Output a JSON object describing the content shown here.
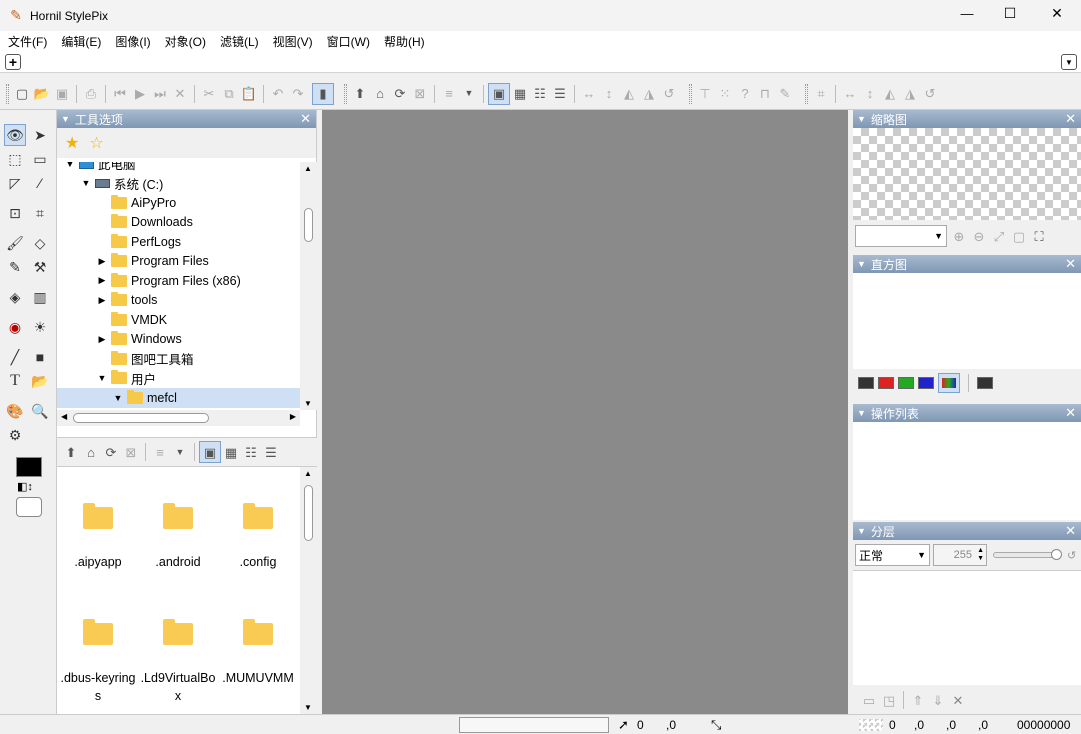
{
  "window": {
    "title": "Hornil StylePix",
    "minimize": "—",
    "maximize": "☐",
    "close": "✕"
  },
  "menu": [
    "文件(F)",
    "编辑(E)",
    "图像(I)",
    "对象(O)",
    "滤镜(L)",
    "视图(V)",
    "窗口(W)",
    "帮助(H)"
  ],
  "tool_options": {
    "title": "工具选项",
    "tree": [
      {
        "label": "此电脑",
        "indent": 1,
        "arrow": "down",
        "icon": "pc"
      },
      {
        "label": "系统 (C:)",
        "indent": 2,
        "arrow": "down",
        "icon": "drive"
      },
      {
        "label": "AiPyPro",
        "indent": 3,
        "arrow": "",
        "icon": "folder"
      },
      {
        "label": "Downloads",
        "indent": 3,
        "arrow": "",
        "icon": "folder"
      },
      {
        "label": "PerfLogs",
        "indent": 3,
        "arrow": "",
        "icon": "folder"
      },
      {
        "label": "Program Files",
        "indent": 3,
        "arrow": "right",
        "icon": "folder"
      },
      {
        "label": "Program Files (x86)",
        "indent": 3,
        "arrow": "right",
        "icon": "folder"
      },
      {
        "label": "tools",
        "indent": 3,
        "arrow": "right",
        "icon": "folder"
      },
      {
        "label": "VMDK",
        "indent": 3,
        "arrow": "",
        "icon": "folder"
      },
      {
        "label": "Windows",
        "indent": 3,
        "arrow": "right",
        "icon": "folder"
      },
      {
        "label": "图吧工具箱",
        "indent": 3,
        "arrow": "",
        "icon": "folder"
      },
      {
        "label": "用户",
        "indent": 3,
        "arrow": "down",
        "icon": "folder"
      },
      {
        "label": "mefcl",
        "indent": 4,
        "arrow": "down",
        "icon": "folder",
        "selected": true
      }
    ]
  },
  "file_grid": [
    {
      "label": ".aipyapp"
    },
    {
      "label": ".android"
    },
    {
      "label": ".config"
    },
    {
      "label": ".dbus-keyrings"
    },
    {
      "label": ".Ld9VirtualBox"
    },
    {
      "label": ".MUMUVMM"
    }
  ],
  "thumbnail_panel": {
    "title": "缩略图",
    "zoom_value": ""
  },
  "histogram_panel": {
    "title": "直方图"
  },
  "actions_panel": {
    "title": "操作列表"
  },
  "layers_panel": {
    "title": "分层",
    "blend_mode": "正常",
    "opacity": "255"
  },
  "status": {
    "cursor_x": "0",
    "cursor_y": ",0",
    "c1": "0",
    "c2": ",0",
    "c3": ",0",
    "c4": ",0",
    "hex": "00000000"
  },
  "colors": {
    "title_bar": "#f3f3f3",
    "panel_title": "#8da2bd",
    "canvas": "#8a8a8a",
    "selection": "#cfe0f5"
  }
}
